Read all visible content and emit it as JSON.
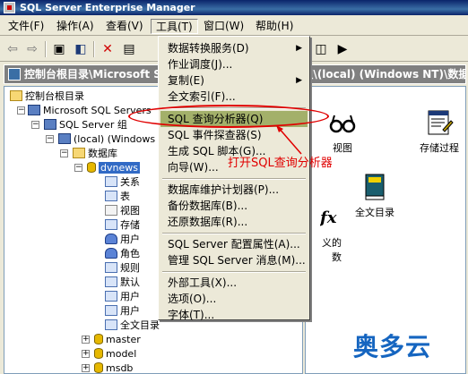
{
  "window": {
    "title": "SQL Server Enterprise Manager"
  },
  "menubar": {
    "items": [
      {
        "label": "文件(F)"
      },
      {
        "label": "操作(A)"
      },
      {
        "label": "查看(V)"
      },
      {
        "label": "工具(T)"
      },
      {
        "label": "窗口(W)"
      },
      {
        "label": "帮助(H)"
      }
    ]
  },
  "pathbar": {
    "text": "控制台根目录\\Microsoft SQL Servers\\SQL Server 组\\(local) (Windows NT)\\数据库\\dvnews"
  },
  "tools_menu": {
    "items": [
      {
        "label": "数据转换服务(D)",
        "submenu": true
      },
      {
        "label": "作业调度(J)..."
      },
      {
        "label": "复制(E)",
        "submenu": true
      },
      {
        "label": "全文索引(F)..."
      },
      {
        "label": "SQL 查询分析器(Q)",
        "highlighted": true
      },
      {
        "label": "SQL 事件探查器(S)"
      },
      {
        "label": "生成 SQL 脚本(G)..."
      },
      {
        "label": "向导(W)..."
      },
      {
        "label": "数据库维护计划器(P)..."
      },
      {
        "label": "备份数据库(B)..."
      },
      {
        "label": "还原数据库(R)..."
      },
      {
        "label": "SQL Server 配置属性(A)..."
      },
      {
        "label": "管理 SQL Server 消息(M)..."
      },
      {
        "label": "外部工具(X)..."
      },
      {
        "label": "选项(O)..."
      },
      {
        "label": "字体(T)..."
      }
    ]
  },
  "tree": {
    "rows": [
      {
        "label": "控制台根目录"
      },
      {
        "label": "Microsoft SQL Servers"
      },
      {
        "label": "SQL Server 组"
      },
      {
        "label": "(local) (Windows"
      },
      {
        "label": "数据库"
      },
      {
        "label": "dvnews"
      },
      {
        "label": "关系"
      },
      {
        "label": "表"
      },
      {
        "label": "视图"
      },
      {
        "label": "存储"
      },
      {
        "label": "用户"
      },
      {
        "label": "角色"
      },
      {
        "label": "规则"
      },
      {
        "label": "默认"
      },
      {
        "label": "用户"
      },
      {
        "label": "用户"
      },
      {
        "label": "全文目录"
      },
      {
        "label": "master"
      },
      {
        "label": "model"
      },
      {
        "label": "msdb"
      }
    ]
  },
  "rightpane": {
    "icons": [
      {
        "label": "视图"
      },
      {
        "label": "存储过程"
      },
      {
        "label": "义的\n数"
      },
      {
        "label": "全文目录"
      }
    ]
  },
  "annotation": {
    "text": "打开SQL查询分析器"
  },
  "watermark": {
    "text": "奥多云"
  },
  "colors": {
    "highlight": "#a3b06a",
    "annotation": "#e00000",
    "selection": "#316ac5"
  }
}
